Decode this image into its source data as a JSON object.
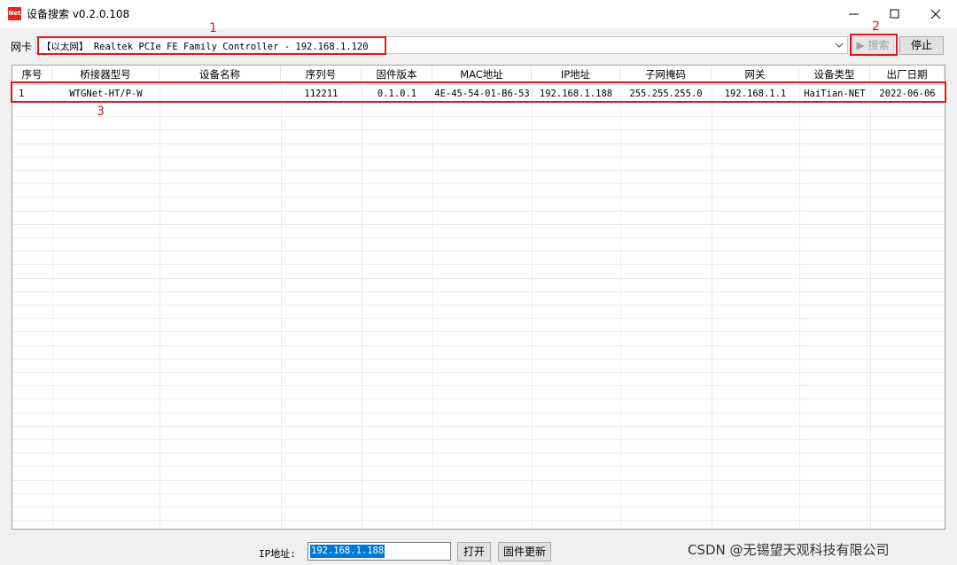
{
  "window": {
    "app_icon_text": "Net",
    "title": "设备搜索 v0.2.0.108",
    "controls": {
      "minimize": "minimize-icon",
      "maximize": "maximize-icon",
      "close": "close-icon"
    }
  },
  "toolbar": {
    "nic_label": "网卡",
    "nic_value": "【以太网】 Realtek PCIe FE Family Controller - 192.168.1.120",
    "search_label": "▶ 搜索",
    "search_enabled": false,
    "stop_label": "停止"
  },
  "annotations": {
    "label_1": "1",
    "label_2": "2",
    "label_3": "3",
    "color": "#e3151c"
  },
  "table": {
    "columns": [
      "序号",
      "桥接器型号",
      "设备名称",
      "序列号",
      "固件版本",
      "MAC地址",
      "IP地址",
      "子网掩码",
      "网关",
      "设备类型",
      "出厂日期"
    ],
    "rows": [
      [
        "1",
        "WTGNet-HT/P-W",
        "",
        "112211",
        "0.1.0.1",
        "4E-45-54-01-B6-53",
        "192.168.1.188",
        "255.255.255.0",
        "192.168.1.1",
        "HaiTian-NET",
        "2022-06-06"
      ]
    ]
  },
  "bottom": {
    "ip_label": "IP地址:",
    "ip_value": "192.168.1.188",
    "open_label": "打开",
    "firmware_update_label": "固件更新"
  },
  "watermark": "CSDN @无锡望天观科技有限公司"
}
